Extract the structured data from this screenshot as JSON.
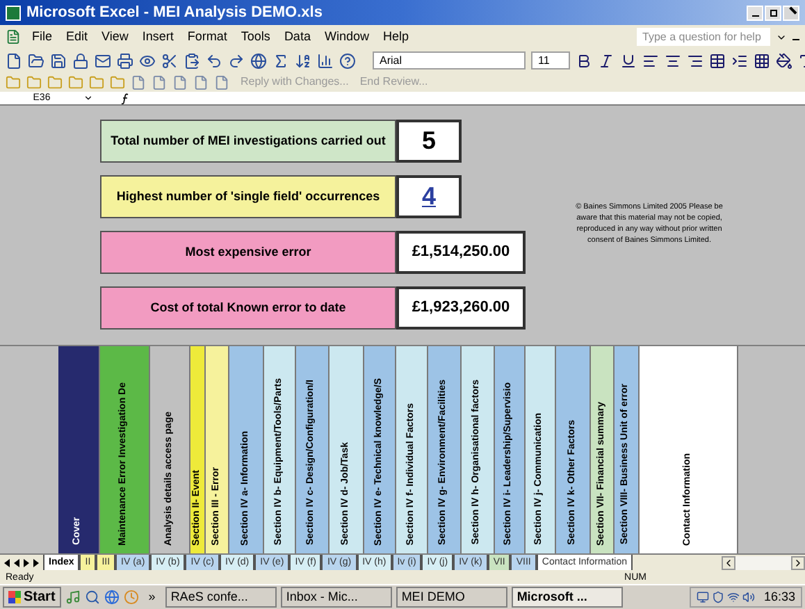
{
  "window": {
    "title": "Microsoft Excel - MEI Analysis DEMO.xls"
  },
  "menu": [
    "File",
    "Edit",
    "View",
    "Insert",
    "Format",
    "Tools",
    "Data",
    "Window",
    "Help"
  ],
  "help_box": {
    "placeholder": "Type a question for help"
  },
  "font_box": {
    "value": "Arial"
  },
  "size_box": {
    "value": "11"
  },
  "review_toolbar": [
    {
      "label": "Reply with Changes...",
      "disabled": true
    },
    {
      "label": "End Review...",
      "disabled": true
    }
  ],
  "name_box": {
    "value": "E36"
  },
  "summary": [
    {
      "label": "Total number of MEI investigations carried out",
      "value": "5",
      "color": "#cfe6c8",
      "kind": "count"
    },
    {
      "label": "Highest number of 'single field' occurrences",
      "value": "4",
      "color": "#f5f29c",
      "kind": "link"
    },
    {
      "label": "Most expensive error",
      "value": "£1,514,250.00",
      "color": "#f29bc1",
      "kind": "money"
    },
    {
      "label": "Cost of total Known error to date",
      "value": "£1,923,260.00",
      "color": "#f29bc1",
      "kind": "money"
    }
  ],
  "copyright_note": "© Baines Simmons Limited 2005 Please be aware that this material may not be copied, reproduced in any way without prior written consent of Baines Simmons Limited.",
  "sections": [
    {
      "label": "Cover",
      "color": "#262a6e"
    },
    {
      "label": "Maintenance Error Investigation De",
      "color": "#5cb947"
    },
    {
      "label": "Analysis details access page",
      "color": "#c0c0c0"
    },
    {
      "label": "Section II- Event",
      "color": "#eeea3a"
    },
    {
      "label": "Section III  - Error",
      "color": "#f6f29c"
    },
    {
      "label": "Section IV a- Information",
      "color": "#9dc3e6"
    },
    {
      "label": "Section IV b- Equipment/Tools/Parts",
      "color": "#cce8f0"
    },
    {
      "label": "Section IV c- Design/Configuration/I",
      "color": "#9dc3e6"
    },
    {
      "label": "Section IV d- Job/Task",
      "color": "#cce8f0"
    },
    {
      "label": "Section IV e- Technical knowledge/S",
      "color": "#9dc3e6"
    },
    {
      "label": "Section IV f-  Individual Factors",
      "color": "#cce8f0"
    },
    {
      "label": "Section IV g- Environment/Facilities",
      "color": "#9dc3e6"
    },
    {
      "label": "Section IV h- Organisational factors",
      "color": "#cce8f0"
    },
    {
      "label": "Section IV i-  Leadership/Supervisio",
      "color": "#9dc3e6"
    },
    {
      "label": "Section IV j- Communication",
      "color": "#cce8f0"
    },
    {
      "label": "Section IV k- Other Factors",
      "color": "#9dc3e6"
    },
    {
      "label": "Section VII- Financial summary",
      "color": "#c9e3c0"
    },
    {
      "label": "Section VIII- Business Unit of error",
      "color": "#9dc3e6"
    },
    {
      "label": "Contact Information",
      "color": "#ffffff"
    }
  ],
  "sheet_tabs": [
    {
      "label": "Index",
      "selected": true,
      "color": "#ffffff"
    },
    {
      "label": "II",
      "selected": false,
      "color": "#f6f29c"
    },
    {
      "label": "III",
      "selected": false,
      "color": "#f6f29c"
    },
    {
      "label": "IV (a)",
      "selected": false,
      "color": "#b8d4ee"
    },
    {
      "label": "IV (b)",
      "selected": false,
      "color": "#d6eef4"
    },
    {
      "label": "IV (c)",
      "selected": false,
      "color": "#b8d4ee"
    },
    {
      "label": "IV (d)",
      "selected": false,
      "color": "#d6eef4"
    },
    {
      "label": "IV (e)",
      "selected": false,
      "color": "#b8d4ee"
    },
    {
      "label": "IV (f)",
      "selected": false,
      "color": "#d6eef4"
    },
    {
      "label": "IV (g)",
      "selected": false,
      "color": "#b8d4ee"
    },
    {
      "label": "IV (h)",
      "selected": false,
      "color": "#d6eef4"
    },
    {
      "label": "Iv (i)",
      "selected": false,
      "color": "#b8d4ee"
    },
    {
      "label": "IV (j)",
      "selected": false,
      "color": "#d6eef4"
    },
    {
      "label": "IV (k)",
      "selected": false,
      "color": "#b8d4ee"
    },
    {
      "label": "VII",
      "selected": false,
      "color": "#c9e3c0"
    },
    {
      "label": "VIII",
      "selected": false,
      "color": "#b8d4ee"
    },
    {
      "label": "Contact Information",
      "selected": false,
      "color": "#ffffff"
    }
  ],
  "status_bar": {
    "status": "Ready",
    "indicator": "NUM"
  },
  "taskbar": {
    "start": "Start",
    "overflow": "»",
    "tasks": [
      {
        "label": "RAeS confe...",
        "selected": false
      },
      {
        "label": "Inbox - Mic...",
        "selected": false
      },
      {
        "label": "MEI DEMO",
        "selected": false
      },
      {
        "label": "Microsoft ...",
        "selected": true
      }
    ],
    "clock": "16:33"
  }
}
